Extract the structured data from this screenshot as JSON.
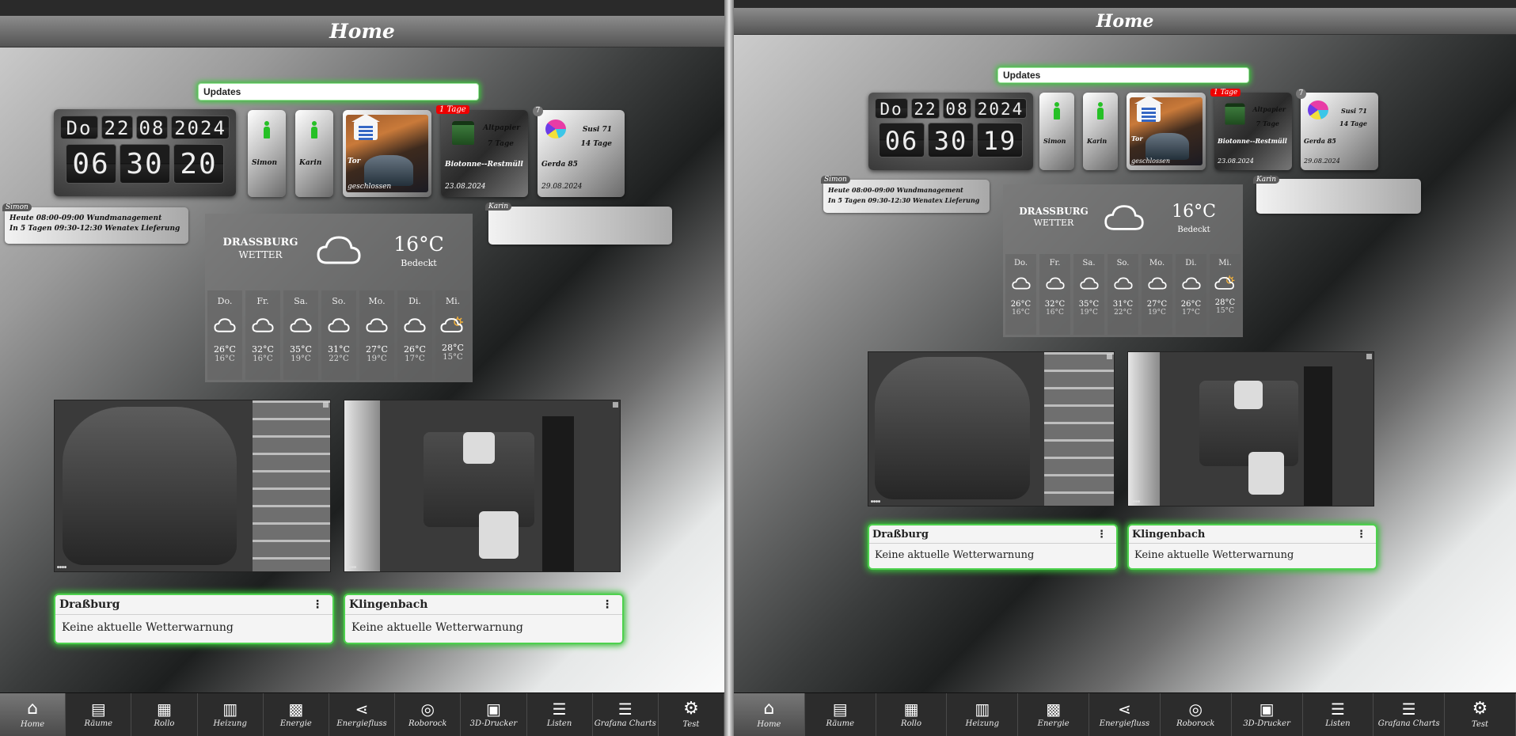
{
  "page_title": "Home",
  "updates_label": "Updates",
  "clock": {
    "date_digits": [
      "Do",
      "22",
      "08",
      "2024"
    ],
    "time_left": [
      "06",
      "30",
      "20"
    ],
    "time_right": [
      "06",
      "30",
      "19"
    ]
  },
  "persons": [
    {
      "name": "Simon"
    },
    {
      "name": "Karin"
    }
  ],
  "garage": {
    "name": "Tor",
    "status": "geschlossen"
  },
  "bins": [
    {
      "badge": "1 Tage",
      "line1": "Altpapier",
      "line2": "7 Tage",
      "name": "Biotonne--Restmüll",
      "date": "23.08.2024"
    },
    {
      "badge": "7",
      "line1": "Susi 71",
      "line2": "14 Tage",
      "name": "Gerda 85",
      "date": "29.08.2024"
    }
  ],
  "calendar_simon": {
    "tag": "Simon",
    "lines": [
      "Heute 08:00-09:00 Wundmanagement",
      "In 5 Tagen 09:30-12:30 Wenatex Lieferung"
    ]
  },
  "calendar_karin": {
    "tag": "Karin",
    "lines": []
  },
  "weather": {
    "city": "DRASSBURG",
    "subtitle": "WETTER",
    "temp": "16°C",
    "condition": "Bedeckt",
    "forecast": [
      {
        "day": "Do.",
        "icon": "cloud-icon",
        "hi": "26°C",
        "lo": "16°C"
      },
      {
        "day": "Fr.",
        "icon": "cloud-icon",
        "hi": "32°C",
        "lo": "16°C"
      },
      {
        "day": "Sa.",
        "icon": "cloud-icon",
        "hi": "35°C",
        "lo": "19°C"
      },
      {
        "day": "So.",
        "icon": "cloud-icon",
        "hi": "31°C",
        "lo": "22°C"
      },
      {
        "day": "Mo.",
        "icon": "cloud-icon",
        "hi": "27°C",
        "lo": "19°C"
      },
      {
        "day": "Di.",
        "icon": "cloud-icon",
        "hi": "26°C",
        "lo": "17°C"
      },
      {
        "day": "Mi.",
        "icon": "partly-sunny-icon",
        "hi": "28°C",
        "lo": "15°C"
      }
    ]
  },
  "cameras": [
    {
      "name": "garage-camera"
    },
    {
      "name": "living-room-camera"
    }
  ],
  "warnings": [
    {
      "location": "Draßburg",
      "message": "Keine aktuelle Wetterwarnung"
    },
    {
      "location": "Klingenbach",
      "message": "Keine aktuelle Wetterwarnung"
    }
  ],
  "nav": [
    {
      "label": "Home",
      "icon": "home-icon",
      "glyph": "⌂"
    },
    {
      "label": "Räume",
      "icon": "rooms-icon",
      "glyph": "▤"
    },
    {
      "label": "Rollo",
      "icon": "blinds-icon",
      "glyph": "▦"
    },
    {
      "label": "Heizung",
      "icon": "radiator-icon",
      "glyph": "▥"
    },
    {
      "label": "Energie",
      "icon": "solar-panel-icon",
      "glyph": "▩"
    },
    {
      "label": "Energiefluss",
      "icon": "share-icon",
      "glyph": "⋖"
    },
    {
      "label": "Roborock",
      "icon": "robot-vacuum-icon",
      "glyph": "◎"
    },
    {
      "label": "3D-Drucker",
      "icon": "printer-3d-icon",
      "glyph": "▣"
    },
    {
      "label": "Listen",
      "icon": "list-icon",
      "glyph": "☰"
    },
    {
      "label": "Grafana Charts",
      "icon": "chart-list-icon",
      "glyph": "☰"
    },
    {
      "label": "Test",
      "icon": "gear-icon",
      "glyph": "⚙"
    }
  ],
  "colors": {
    "accent_green": "#38c038",
    "badge_red": "#ee0000",
    "person_green": "#26c026"
  }
}
